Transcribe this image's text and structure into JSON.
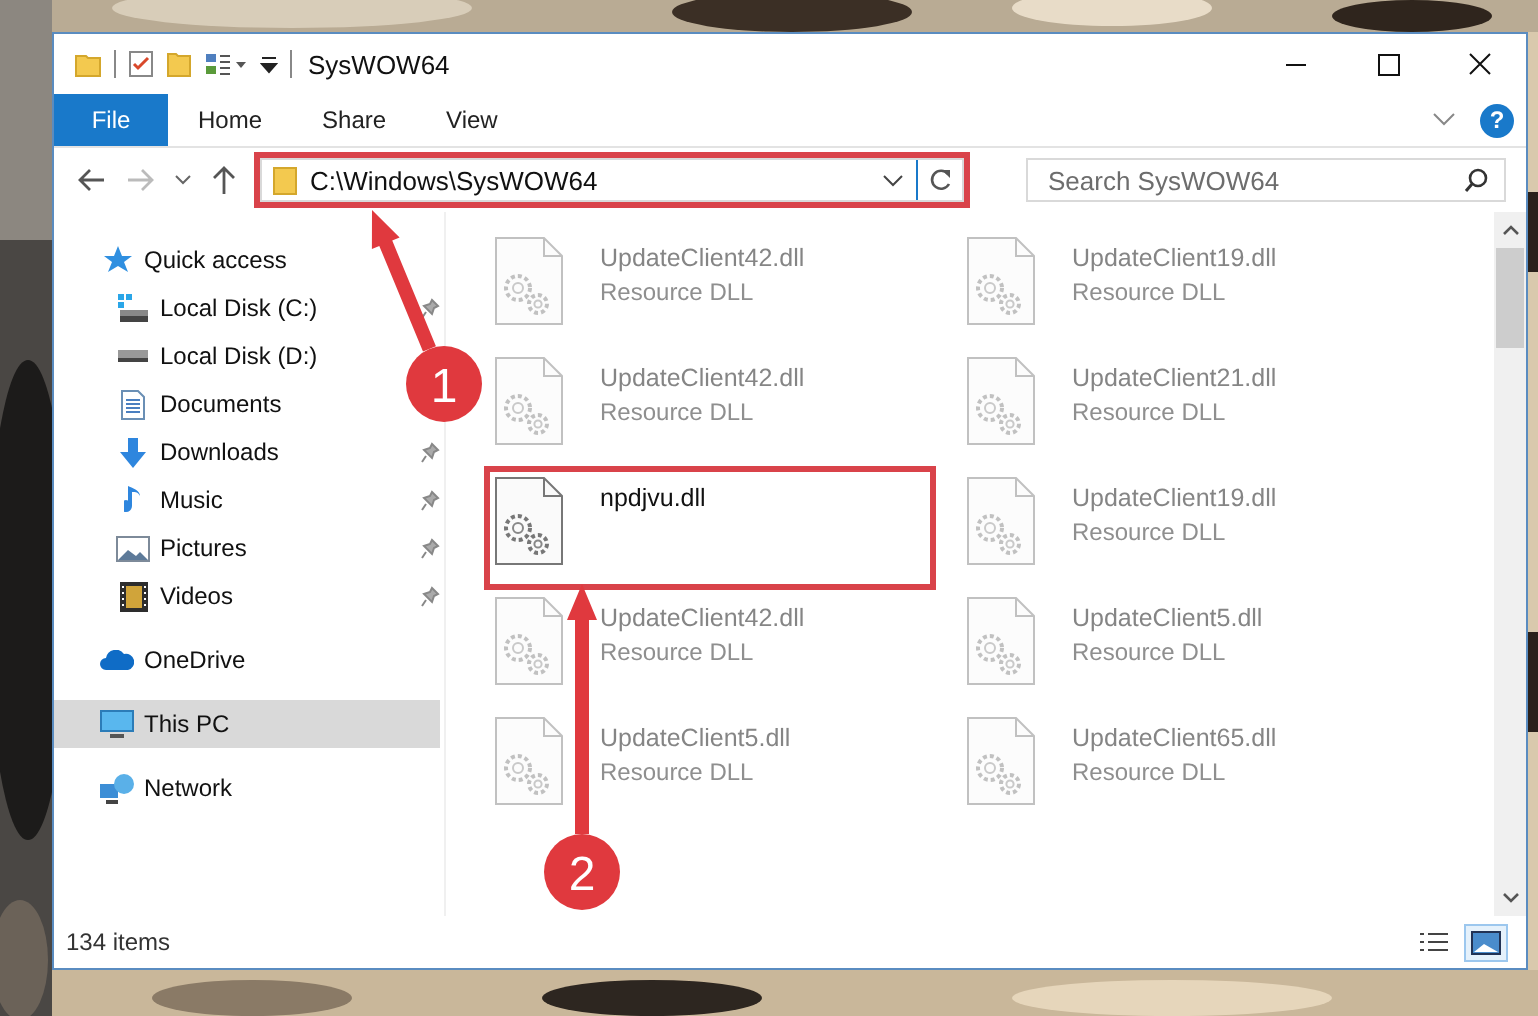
{
  "window": {
    "title": "SysWOW64"
  },
  "ribbon": {
    "tabs": [
      {
        "label": "File",
        "kind": "file"
      },
      {
        "label": "Home",
        "kind": "tab"
      },
      {
        "label": "Share",
        "kind": "tab"
      },
      {
        "label": "View",
        "kind": "tab"
      }
    ],
    "help": "?"
  },
  "address": {
    "path": "C:\\Windows\\SysWOW64",
    "highlighted": true
  },
  "search": {
    "placeholder": "Search SysWOW64"
  },
  "navigation": [
    {
      "label": "Quick access",
      "kind": "star",
      "selected": false,
      "children": [
        {
          "label": "Local Disk (C:)",
          "kind": "drive-windows",
          "pinned": true,
          "selected": false
        },
        {
          "label": "Local Disk (D:)",
          "kind": "drive",
          "pinned": false,
          "selected": false
        },
        {
          "label": "Documents",
          "kind": "documents",
          "pinned": false,
          "selected": false
        },
        {
          "label": "Downloads",
          "kind": "downloads",
          "pinned": true,
          "selected": false
        },
        {
          "label": "Music",
          "kind": "music",
          "pinned": true,
          "selected": false
        },
        {
          "label": "Pictures",
          "kind": "pictures",
          "pinned": true,
          "selected": false
        },
        {
          "label": "Videos",
          "kind": "videos",
          "pinned": true,
          "selected": false
        }
      ]
    },
    {
      "label": "OneDrive",
      "kind": "cloud",
      "selected": false
    },
    {
      "label": "This PC",
      "kind": "pc",
      "selected": true
    },
    {
      "label": "Network",
      "kind": "network",
      "selected": false
    }
  ],
  "files": [
    {
      "name": "UpdateClient42.dll",
      "description": "Resource DLL",
      "blurred": true,
      "highlighted": false
    },
    {
      "name": "UpdateClient19.dll",
      "description": "Resource DLL",
      "blurred": true,
      "highlighted": false
    },
    {
      "name": "UpdateClient42.dll",
      "description": "Resource DLL",
      "blurred": true,
      "highlighted": false
    },
    {
      "name": "UpdateClient21.dll",
      "description": "Resource DLL",
      "blurred": true,
      "highlighted": false
    },
    {
      "name": "npdjvu.dll",
      "blurred": false,
      "highlighted": true
    },
    {
      "name": "UpdateClient19.dll",
      "description": "Resource DLL",
      "blurred": true,
      "highlighted": false
    },
    {
      "name": "UpdateClient42.dll",
      "description": "Resource DLL",
      "blurred": true,
      "highlighted": false
    },
    {
      "name": "UpdateClient5.dll",
      "description": "Resource DLL",
      "blurred": true,
      "highlighted": false
    },
    {
      "name": "UpdateClient5.dll",
      "description": "Resource DLL",
      "blurred": true,
      "highlighted": false
    },
    {
      "name": "UpdateClient65.dll",
      "description": "Resource DLL",
      "blurred": true,
      "highlighted": false
    }
  ],
  "status_bar": {
    "item_count": "134 items",
    "view_modes": [
      {
        "kind": "details",
        "selected": false
      },
      {
        "kind": "large-icons",
        "selected": true
      }
    ]
  },
  "annotations": [
    {
      "label": "1"
    },
    {
      "label": "2"
    }
  ]
}
